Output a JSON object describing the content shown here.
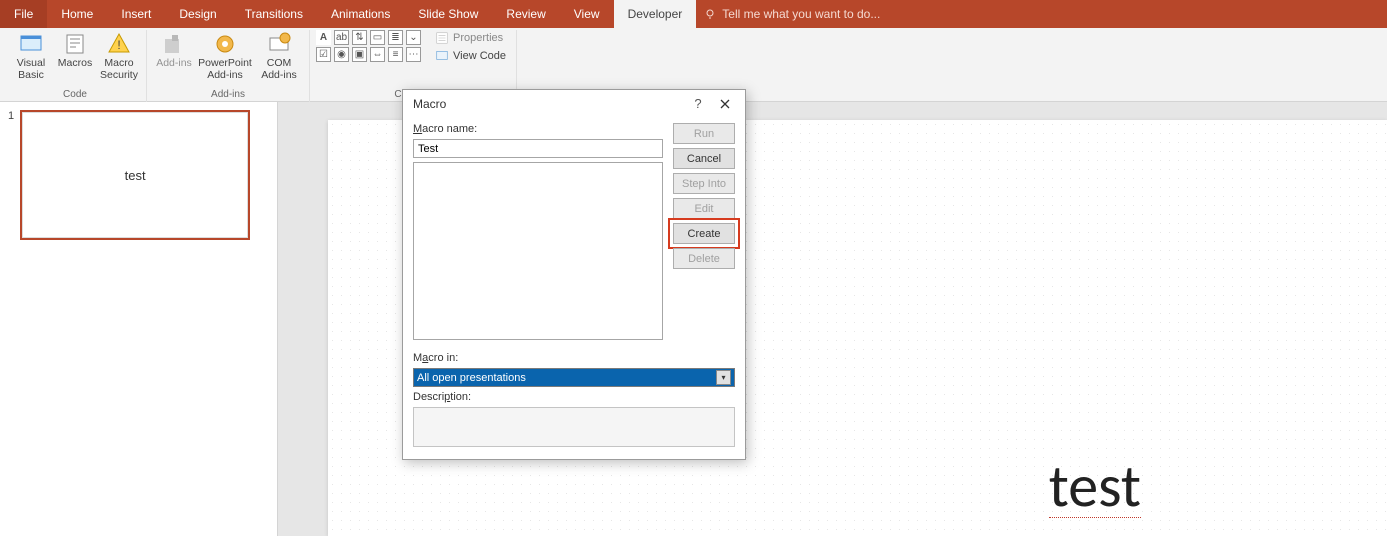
{
  "tabs": {
    "file": "File",
    "home": "Home",
    "insert": "Insert",
    "design": "Design",
    "transitions": "Transitions",
    "animations": "Animations",
    "slideshow": "Slide Show",
    "review": "Review",
    "view": "View",
    "developer": "Developer",
    "tellme": "Tell me what you want to do..."
  },
  "groups": {
    "code": "Code",
    "addins": "Add-ins",
    "controls": "Controls"
  },
  "buttons": {
    "visualBasic": "Visual Basic",
    "macros": "Macros",
    "macroSecurity": "Macro Security",
    "addinsBtn": "Add-ins",
    "pptAddins": "PowerPoint Add-ins",
    "comAddins": "COM Add-ins",
    "properties": "Properties",
    "viewCode": "View Code"
  },
  "panel": {
    "slideNum": "1",
    "thumbText": "test"
  },
  "canvas": {
    "bigText": "test"
  },
  "dialog": {
    "title": "Macro",
    "macroNameLabel": "Macro name:",
    "macroNameValue": "Test",
    "macroInLabel": "Macro in:",
    "macroInValue": "All open presentations",
    "descriptionLabel": "Description:",
    "run": "Run",
    "cancel": "Cancel",
    "stepInto": "Step Into",
    "edit": "Edit",
    "create": "Create",
    "delete": "Delete"
  }
}
